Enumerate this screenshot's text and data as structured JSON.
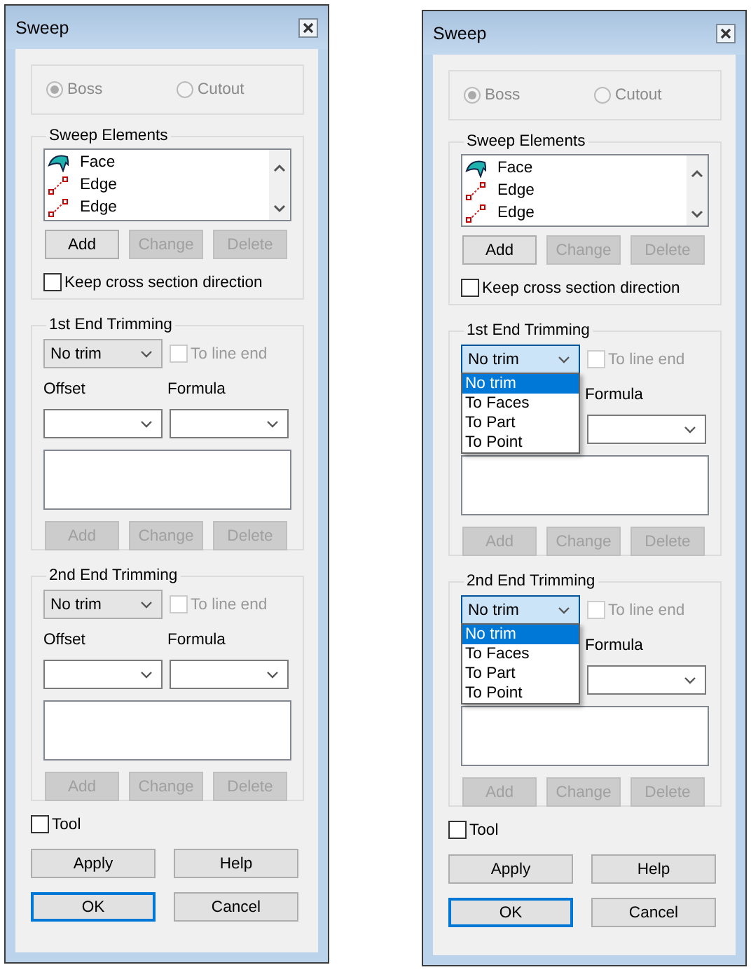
{
  "dialogs": [
    {
      "title": "Sweep",
      "mode": {
        "disabled": true,
        "options": [
          {
            "label": "Boss",
            "selected": true
          },
          {
            "label": "Cutout",
            "selected": false
          }
        ]
      },
      "sweep_elements": {
        "title": "Sweep Elements",
        "items": [
          {
            "kind": "face",
            "label": "Face"
          },
          {
            "kind": "edge",
            "label": "Edge"
          },
          {
            "kind": "edge",
            "label": "Edge"
          }
        ],
        "buttons": [
          {
            "label": "Add",
            "disabled": false
          },
          {
            "label": "Change",
            "disabled": true
          },
          {
            "label": "Delete",
            "disabled": true
          }
        ]
      },
      "keep_direction": {
        "label": "Keep cross section direction",
        "checked": false
      },
      "trimming": [
        {
          "title": "1st End Trimming",
          "trim": {
            "value": "No trim",
            "focused": false
          },
          "to_line_end": {
            "label": "To line end",
            "checked": false,
            "disabled": true
          },
          "offset_label": "Offset",
          "formula_label": "Formula",
          "buttons": [
            {
              "label": "Add",
              "disabled": true
            },
            {
              "label": "Change",
              "disabled": true
            },
            {
              "label": "Delete",
              "disabled": true
            }
          ]
        },
        {
          "title": "2nd End Trimming",
          "trim": {
            "value": "No trim",
            "focused": false
          },
          "to_line_end": {
            "label": "To line end",
            "checked": false,
            "disabled": true
          },
          "offset_label": "Offset",
          "formula_label": "Formula",
          "buttons": [
            {
              "label": "Add",
              "disabled": true
            },
            {
              "label": "Change",
              "disabled": true
            },
            {
              "label": "Delete",
              "disabled": true
            }
          ]
        }
      ],
      "tool": {
        "label": "Tool",
        "checked": false
      },
      "actions": [
        {
          "label": "Apply",
          "default": false
        },
        {
          "label": "Help",
          "default": false
        },
        {
          "label": "OK",
          "default": true
        },
        {
          "label": "Cancel",
          "default": false
        }
      ]
    },
    {
      "title": "Sweep",
      "mode": {
        "disabled": true,
        "options": [
          {
            "label": "Boss",
            "selected": true
          },
          {
            "label": "Cutout",
            "selected": false
          }
        ]
      },
      "sweep_elements": {
        "title": "Sweep Elements",
        "items": [
          {
            "kind": "face",
            "label": "Face"
          },
          {
            "kind": "edge",
            "label": "Edge"
          },
          {
            "kind": "edge",
            "label": "Edge"
          }
        ],
        "buttons": [
          {
            "label": "Add",
            "disabled": false
          },
          {
            "label": "Change",
            "disabled": true
          },
          {
            "label": "Delete",
            "disabled": true
          }
        ]
      },
      "keep_direction": {
        "label": "Keep cross section direction",
        "checked": false
      },
      "trimming": [
        {
          "title": "1st End Trimming",
          "trim": {
            "value": "No trim",
            "focused": true
          },
          "to_line_end": {
            "label": "To line end",
            "checked": false,
            "disabled": true
          },
          "formula_label": "Formula",
          "dropdown": [
            {
              "label": "No trim",
              "selected": true
            },
            {
              "label": "To Faces",
              "selected": false
            },
            {
              "label": "To Part",
              "selected": false
            },
            {
              "label": "To Point",
              "selected": false
            }
          ],
          "buttons": [
            {
              "label": "Add",
              "disabled": true
            },
            {
              "label": "Change",
              "disabled": true
            },
            {
              "label": "Delete",
              "disabled": true
            }
          ]
        },
        {
          "title": "2nd End Trimming",
          "trim": {
            "value": "No trim",
            "focused": true
          },
          "to_line_end": {
            "label": "To line end",
            "checked": false,
            "disabled": true
          },
          "formula_label": "Formula",
          "dropdown": [
            {
              "label": "No trim",
              "selected": true
            },
            {
              "label": "To Faces",
              "selected": false
            },
            {
              "label": "To Part",
              "selected": false
            },
            {
              "label": "To Point",
              "selected": false
            }
          ],
          "buttons": [
            {
              "label": "Add",
              "disabled": true
            },
            {
              "label": "Change",
              "disabled": true
            },
            {
              "label": "Delete",
              "disabled": true
            }
          ]
        }
      ],
      "tool": {
        "label": "Tool",
        "checked": false
      },
      "actions": [
        {
          "label": "Apply",
          "default": false
        },
        {
          "label": "Help",
          "default": false
        },
        {
          "label": "OK",
          "default": true
        },
        {
          "label": "Cancel",
          "default": false
        }
      ]
    }
  ]
}
